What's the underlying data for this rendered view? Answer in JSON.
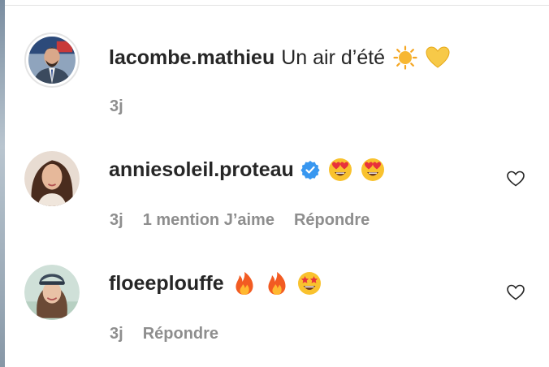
{
  "comments": [
    {
      "username": "lacombe.mathieu",
      "text": "Un air d’été",
      "emojis": [
        "sun-emoji",
        "yellow-heart-emoji"
      ],
      "time": "3j",
      "verified": false
    },
    {
      "username": "anniesoleil.proteau",
      "text": "",
      "emojis": [
        "heart-eyes-emoji",
        "heart-eyes-emoji"
      ],
      "time": "3j",
      "likes": "1 mention J’aime",
      "reply": "Répondre",
      "verified": true
    },
    {
      "username": "floeeplouffe",
      "text": "",
      "emojis": [
        "fire-emoji",
        "fire-emoji",
        "star-struck-emoji"
      ],
      "time": "3j",
      "reply": "Répondre",
      "verified": false
    }
  ],
  "colors": {
    "text": "#262626",
    "secondary": "#8e8e8e",
    "verified": "#3897f0"
  }
}
